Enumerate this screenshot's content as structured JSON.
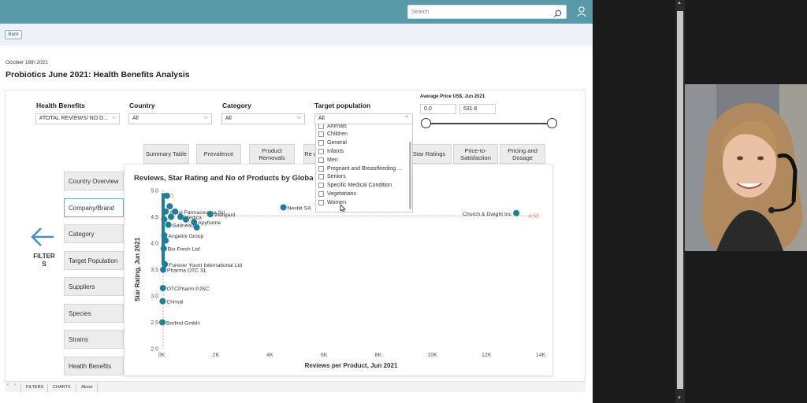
{
  "search": {
    "placeholder": "Search"
  },
  "back_label": "Back",
  "date": "October 18th 2021",
  "page_title": "Probiotics June 2021: Health Benefits Analysis",
  "filters": {
    "health_benefits": {
      "label": "Health Benefits",
      "value": "#TOTAL REVIEWS/ NO D..."
    },
    "country": {
      "label": "Country",
      "value": "All"
    },
    "category": {
      "label": "Category",
      "value": "All"
    },
    "target_population": {
      "label": "Target population",
      "value": "All",
      "options": [
        "Animals",
        "Children",
        "General",
        "Infants",
        "Men",
        "Pregnant and Breastfeeding ...",
        "Seniors",
        "Specific Medical Condition",
        "Vegetarians",
        "Women"
      ]
    },
    "price": {
      "label": "Average Price US$, Jun 2021",
      "min": "0.0",
      "max": "531.6"
    }
  },
  "tabs": [
    "Summary Table",
    "Prevalence",
    "Product Removals",
    "Re ai",
    "Star Ratings",
    "Price-to-Satisfaction",
    "Pricing and Dosage"
  ],
  "nav": {
    "items": [
      "Country Overview",
      "Company/Brand",
      "Category",
      "Target Population",
      "Suppliers",
      "Species",
      "Strains",
      "Health Benefits"
    ],
    "active": "Company/Brand",
    "filters_label_1": "FILTER",
    "filters_label_2": "S"
  },
  "chart_data": {
    "type": "scatter",
    "title": "Reviews, Star Rating and No of Products by Globa",
    "xlabel": "Reviews per Product, Jun 2021",
    "ylabel": "Star Rating, Jun 2021",
    "xlim": [
      0,
      14000
    ],
    "ylim": [
      2.0,
      5.0
    ],
    "x_ticks": [
      "0K",
      "2K",
      "4K",
      "6K",
      "8K",
      "10K",
      "12K",
      "14K"
    ],
    "y_ticks": [
      "2.0",
      "2.5",
      "3.0",
      "3.5",
      "4.0",
      "4.5",
      "5.0"
    ],
    "avg_line_value": 4.52,
    "avg_line_label": "4.52",
    "avg_x_label": "15",
    "color": "#1f7f99",
    "points": [
      {
        "label": "Church & Dwight Inc",
        "x": 13100,
        "y": 4.57
      },
      {
        "label": "Nestlé SA",
        "x": 4500,
        "y": 4.68
      },
      {
        "label": "Actial Farmaceutica Srl",
        "x": 150,
        "y": 4.6
      },
      {
        "label": "Medica",
        "x": 700,
        "y": 4.5
      },
      {
        "label": "Apyforme",
        "x": 1200,
        "y": 4.4
      },
      {
        "label": "Wellgard",
        "x": 1800,
        "y": 4.55
      },
      {
        "label": "Gatineau",
        "x": 250,
        "y": 4.35
      },
      {
        "label": "Angelini Group",
        "x": 100,
        "y": 4.15
      },
      {
        "label": "Bio Fresh Ltd",
        "x": 80,
        "y": 3.9
      },
      {
        "label": "Forever Yount International Ltd",
        "x": 120,
        "y": 3.6
      },
      {
        "label": "Pharma OTC SL",
        "x": 60,
        "y": 3.5
      },
      {
        "label": "OTCPharm PJSC",
        "x": 50,
        "y": 3.15
      },
      {
        "label": "Chrisal",
        "x": 40,
        "y": 2.9
      },
      {
        "label": "Borlind GmbH",
        "x": 30,
        "y": 2.5
      },
      {
        "label": "",
        "x": 200,
        "y": 4.9
      },
      {
        "label": "",
        "x": 300,
        "y": 4.7
      },
      {
        "label": "",
        "x": 500,
        "y": 4.6
      },
      {
        "label": "",
        "x": 900,
        "y": 4.45
      },
      {
        "label": "",
        "x": 1300,
        "y": 4.3
      },
      {
        "label": "",
        "x": 150,
        "y": 4.05
      },
      {
        "label": "",
        "x": 100,
        "y": 4.45
      },
      {
        "label": "",
        "x": 350,
        "y": 4.5
      }
    ]
  },
  "bottom_tabs": [
    "FILTERS",
    "CHARTS",
    "About"
  ]
}
